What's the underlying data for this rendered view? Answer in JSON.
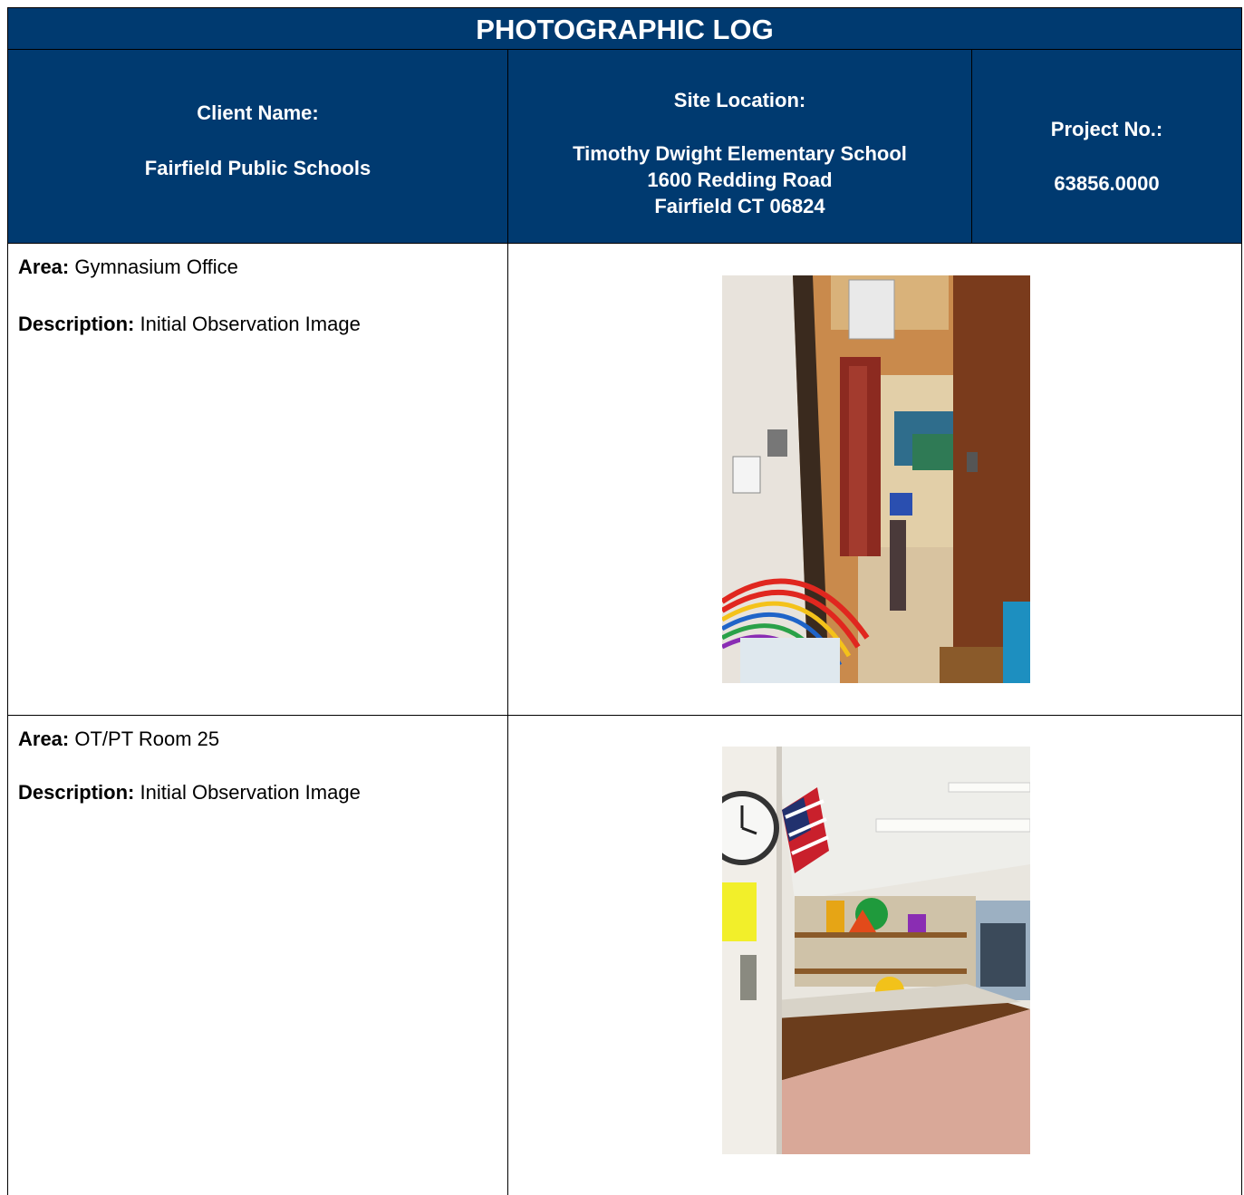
{
  "header": {
    "title": "PHOTOGRAPHIC LOG",
    "client_label": "Client Name:",
    "client_value": "Fairfield Public Schools",
    "site_label": "Site Location:",
    "site_lines": [
      "Timothy Dwight Elementary School",
      "1600 Redding Road",
      "Fairfield CT 06824"
    ],
    "project_label": "Project No.:",
    "project_value": "63856.0000"
  },
  "entries": [
    {
      "area_label": "Area:",
      "area": "Gymnasium Office",
      "description_label": "Description:",
      "description": "Initial Observation Image"
    },
    {
      "area_label": "Area:",
      "area": "OT/PT Room 25",
      "description_label": "Description:",
      "description": "Initial Observation Image"
    }
  ],
  "colors": {
    "header_bg": "#003a70",
    "header_text": "#ffffff",
    "border": "#000000"
  }
}
